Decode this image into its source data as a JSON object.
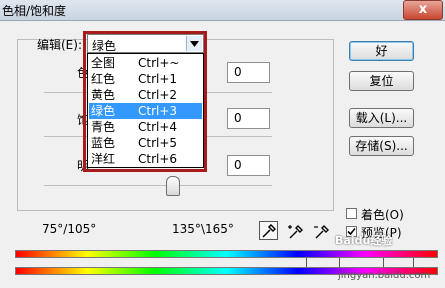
{
  "window": {
    "title": "色相/饱和度",
    "close_symbol": "x"
  },
  "edit": {
    "label": "编辑(E):",
    "selected": "绿色"
  },
  "dropdown": {
    "items": [
      {
        "name": "全图",
        "shortcut": "Ctrl+~",
        "selected": false
      },
      {
        "name": "红色",
        "shortcut": "Ctrl+1",
        "selected": false
      },
      {
        "name": "黄色",
        "shortcut": "Ctrl+2",
        "selected": false
      },
      {
        "name": "绿色",
        "shortcut": "Ctrl+3",
        "selected": true
      },
      {
        "name": "青色",
        "shortcut": "Ctrl+4",
        "selected": false
      },
      {
        "name": "蓝色",
        "shortcut": "Ctrl+5",
        "selected": false
      },
      {
        "name": "洋红",
        "shortcut": "Ctrl+6",
        "selected": false
      }
    ]
  },
  "partial_labels": {
    "hue": "色",
    "saturation": "饱",
    "lightness": "明"
  },
  "values": {
    "hue": "0",
    "saturation": "0",
    "lightness": "0"
  },
  "buttons": {
    "ok": "好",
    "reset": "复位",
    "load": "载入(L)...",
    "save": "存储(S)..."
  },
  "range": {
    "left": "75°/105°",
    "right": "135°\\165°"
  },
  "options": {
    "colorize": "着色(O)",
    "colorize_checked": false,
    "preview": "预览(P)",
    "preview_checked": true
  },
  "watermark": {
    "text": "Baidu经验",
    "url": "jingyan.baidu.com"
  }
}
